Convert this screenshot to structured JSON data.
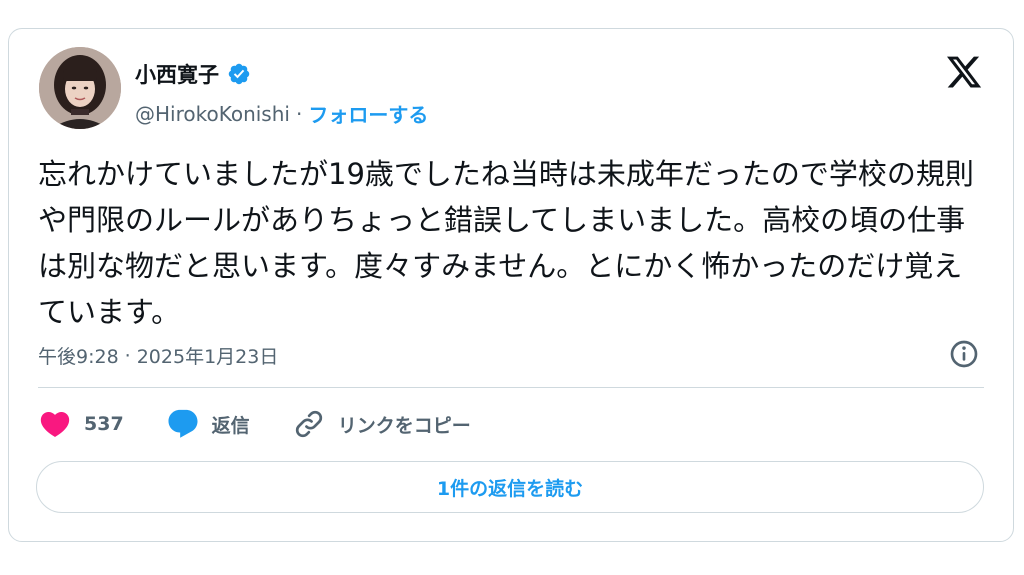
{
  "author": {
    "display_name": "小西寛子",
    "handle": "@HirokoKonishi",
    "separator": "·",
    "follow_label": "フォローする"
  },
  "tweet": {
    "text": "忘れかけていましたが19歳でしたね当時は未成年だったので学校の規則や門限のルールがありちょっと錯誤してしまいました。高校の頃の仕事は別な物だと思います。度々すみません。とにかく怖かったのだけ覚えています。",
    "time": "午後9:28",
    "separator": "·",
    "date": "2025年1月23日"
  },
  "actions": {
    "like_count": "537",
    "reply_label": "返信",
    "copy_link_label": "リンクをコピー"
  },
  "read_replies_label": "1件の返信を読む",
  "colors": {
    "accent": "#1d9bf0",
    "like": "#f91880",
    "text": "#0f1419",
    "secondary": "#536471",
    "border": "#cfd9de"
  },
  "icons": {
    "verified": "verified-badge-icon",
    "logo": "x-logo-icon",
    "info": "info-icon",
    "like": "heart-icon",
    "reply": "speech-bubble-icon",
    "copy": "link-icon"
  }
}
